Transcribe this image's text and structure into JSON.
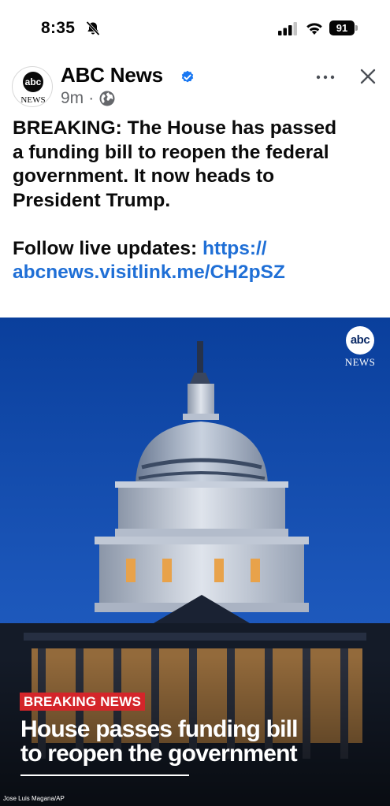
{
  "status_bar": {
    "time": "8:35",
    "battery_level": "91",
    "icons": [
      "bell-slash-icon",
      "signal-icon",
      "wifi-icon",
      "battery-icon"
    ]
  },
  "post": {
    "author": "ABC News",
    "avatar_text_top": "abc",
    "avatar_text_bottom": "NEWS",
    "time_ago": "9m",
    "separator": "·",
    "verified": true,
    "text_line1": "BREAKING: The House has passed",
    "text_line2": "a funding bill to reopen the federal",
    "text_line3": "government. It now heads to",
    "text_line4": "President Trump.",
    "follow_label": "Follow live updates: ",
    "link_part1": "https://",
    "link_part2": "abcnews.visitlink.me/CH2pSZ"
  },
  "image": {
    "watermark_top": "abc",
    "watermark_bottom": "NEWS",
    "badge": "BREAKING NEWS",
    "headline_line1": "House passes funding bill",
    "headline_line2": "to reopen the government",
    "credit": "Jose Luis Magana/AP"
  },
  "colors": {
    "link": "#1f6fd6",
    "verified": "#1877f2",
    "badge": "#d4252a",
    "sky_top": "#0a3f9c",
    "sky_bottom": "#2a66c9"
  }
}
